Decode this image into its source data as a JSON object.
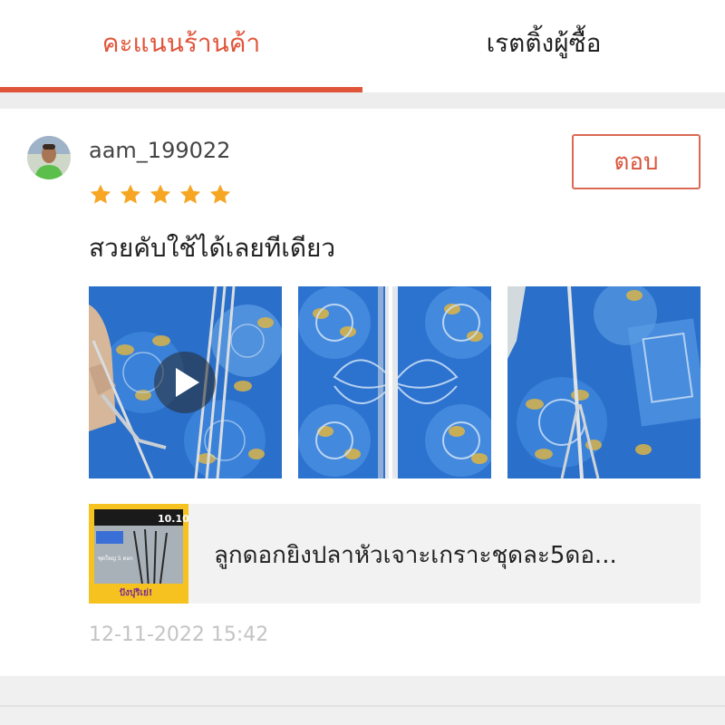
{
  "tabs": {
    "shop_rating": "คะแนนร้านค้า",
    "buyer_rating": "เรตติ้งผู้ซื้อ"
  },
  "review": {
    "username": "aam_199022",
    "rating": 5,
    "reply_label": "ตอบ",
    "comment": "สวยคับใช้ได้เลยทีเดียว",
    "media": [
      {
        "type": "video",
        "icon": "play-icon"
      },
      {
        "type": "image"
      },
      {
        "type": "image"
      }
    ],
    "product": {
      "name": "ลูกดอกยิงปลาหัวเจาะเกราะชุดละ5ดอ...",
      "thumb_badge": "10.10",
      "thumb_text": "ชุดใหญ่ 5 ดอก",
      "thumb_banner": "ปังปุริเย่!"
    },
    "timestamp": "12-11-2022 15:42"
  },
  "colors": {
    "accent": "#e0553a",
    "star": "#f6a623",
    "timestamp": "#c4c4c4"
  }
}
